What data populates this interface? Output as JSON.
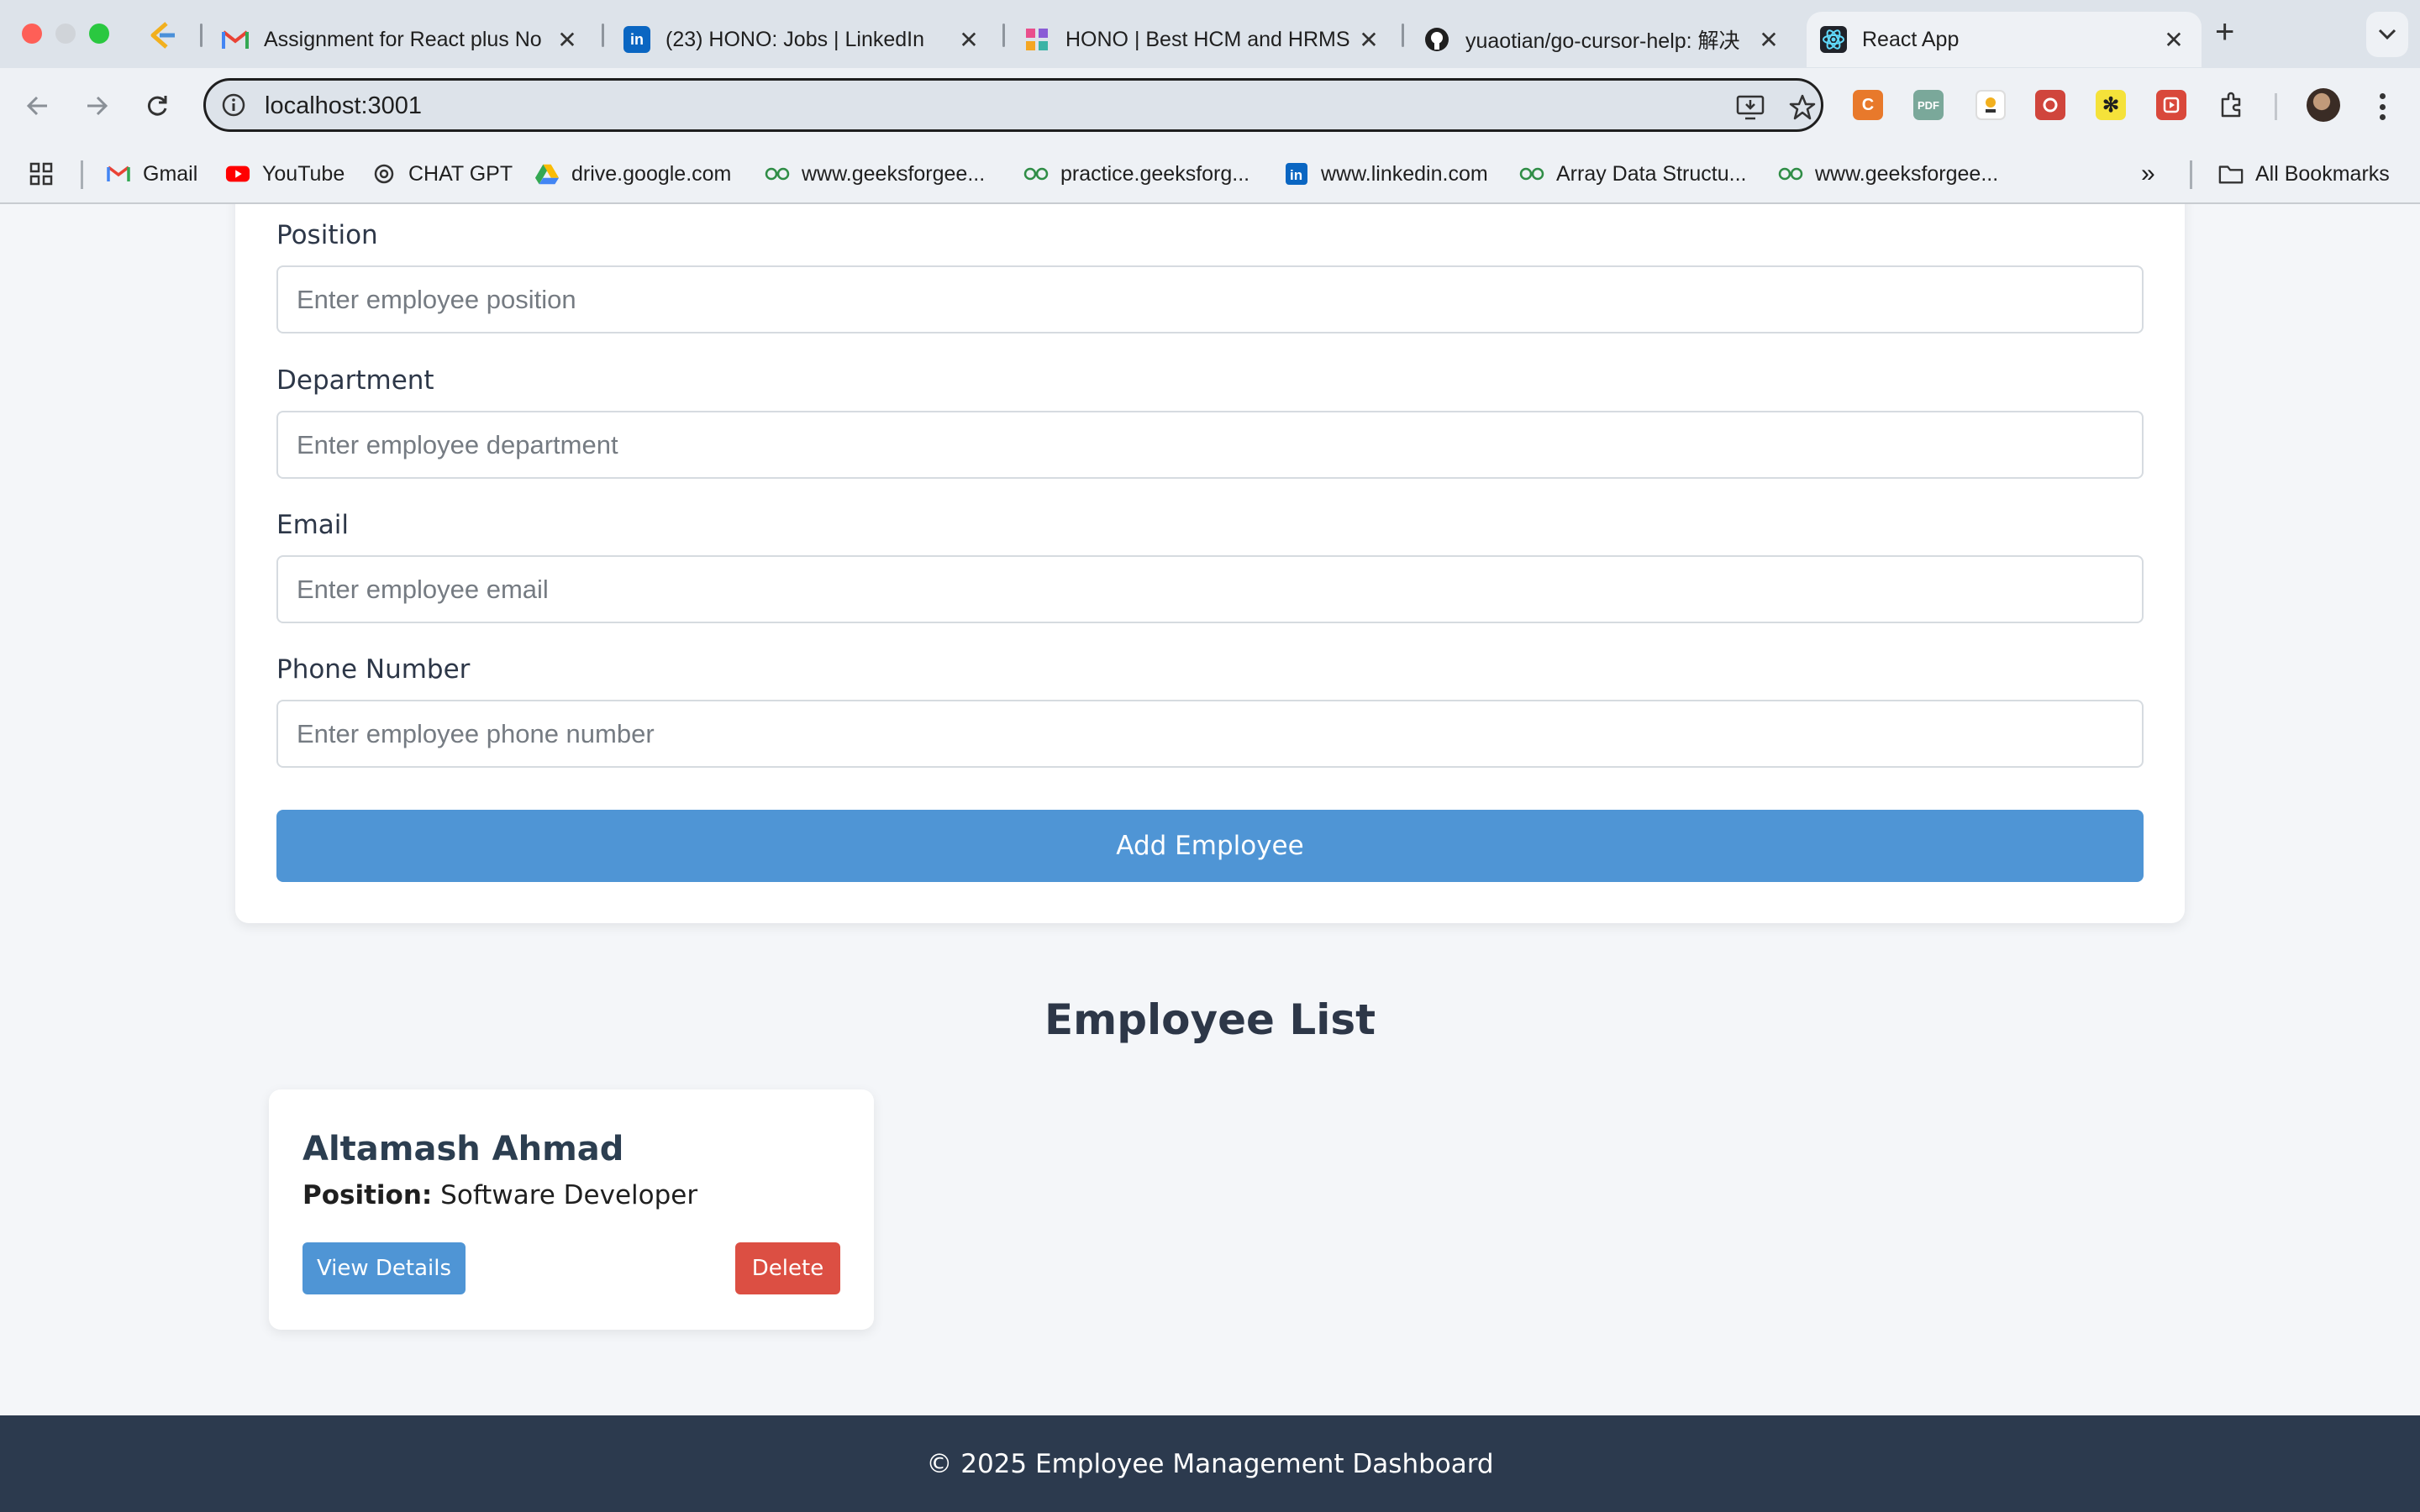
{
  "browser": {
    "tabs": [
      {
        "title": "Assignment for React plus No",
        "favicon": "gmail-icon"
      },
      {
        "title": "(23) HONO: Jobs | LinkedIn",
        "favicon": "linkedin-icon"
      },
      {
        "title": "HONO | Best HCM and HRMS",
        "favicon": "hono-icon"
      },
      {
        "title": "yuaotian/go-cursor-help: 解决",
        "favicon": "github-icon"
      },
      {
        "title": "React App",
        "favicon": "react-icon",
        "active": true
      }
    ],
    "url": "localhost:3001",
    "bookmarks": [
      {
        "label": "Gmail",
        "icon": "gmail-icon"
      },
      {
        "label": "YouTube",
        "icon": "youtube-icon"
      },
      {
        "label": "CHAT GPT",
        "icon": "openai-icon"
      },
      {
        "label": "drive.google.com",
        "icon": "google-drive-icon"
      },
      {
        "label": "www.geeksforgee...",
        "icon": "geeksforgeeks-icon"
      },
      {
        "label": "practice.geeksforg...",
        "icon": "geeksforgeeks-icon"
      },
      {
        "label": "www.linkedin.com",
        "icon": "linkedin-icon"
      },
      {
        "label": "Array Data Structu...",
        "icon": "geeksforgeeks-icon"
      },
      {
        "label": "www.geeksforgee...",
        "icon": "geeksforgeeks-icon"
      }
    ],
    "all_bookmarks": "All Bookmarks",
    "extensions": [
      {
        "icon": "c-extension-icon",
        "text": "C",
        "color": "#e8792b"
      },
      {
        "icon": "pdf-extension-icon",
        "text": "PDF",
        "color": "#7aa89a"
      },
      {
        "icon": "badge-extension-icon",
        "text": "",
        "color": "#f2b01e"
      },
      {
        "icon": "puzzle-red-extension-icon",
        "text": "",
        "color": "#d0453c"
      },
      {
        "icon": "asterisk-extension-icon",
        "text": "✻",
        "color": "#f5e23a"
      },
      {
        "icon": "video-extension-icon",
        "text": "",
        "color": "#d9483b"
      }
    ]
  },
  "form": {
    "fields": [
      {
        "label": "Position",
        "placeholder": "Enter employee position"
      },
      {
        "label": "Department",
        "placeholder": "Enter employee department"
      },
      {
        "label": "Email",
        "placeholder": "Enter employee email"
      },
      {
        "label": "Phone Number",
        "placeholder": "Enter employee phone number"
      }
    ],
    "submit_label": "Add Employee"
  },
  "employee_list": {
    "title": "Employee List",
    "employees": [
      {
        "name": "Altamash Ahmad",
        "position_label": "Position:",
        "position": "Software Developer",
        "view_label": "View Details",
        "delete_label": "Delete"
      }
    ]
  },
  "footer": {
    "text": "© 2025 Employee Management Dashboard"
  },
  "colors": {
    "primary": "#4f95d5",
    "danger": "#dc4f43",
    "footer_bg": "#2c3a4e",
    "page_bg": "#f4f6f9"
  }
}
